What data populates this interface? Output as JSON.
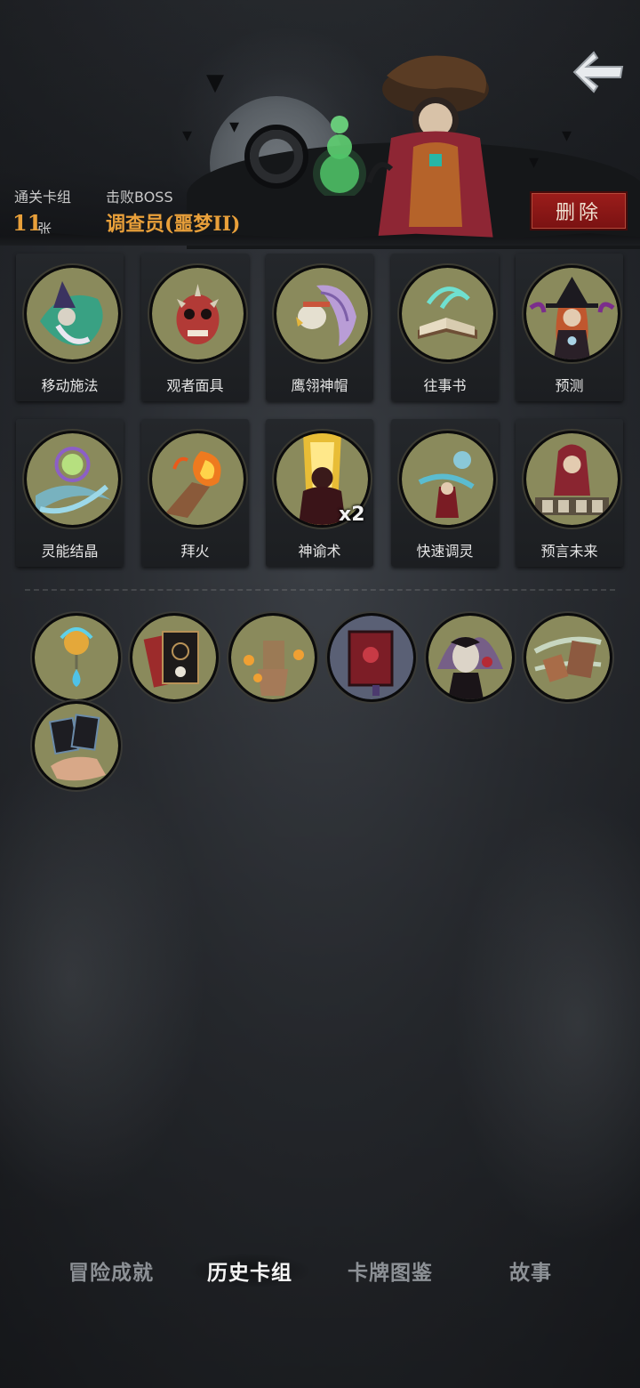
{
  "header": {
    "cleared_deck_label": "通关卡组",
    "card_count": "11",
    "card_unit": "张",
    "defeated_boss_label": "击败BOSS",
    "boss_name": "调查员(噩梦II)",
    "delete_label": "删除"
  },
  "cards": [
    {
      "name": "移动施法",
      "icon": "wizard-icon"
    },
    {
      "name": "观者面具",
      "icon": "mask-icon"
    },
    {
      "name": "鹰翎神帽",
      "icon": "feather-headdress-icon"
    },
    {
      "name": "往事书",
      "icon": "book-icon"
    },
    {
      "name": "预测",
      "icon": "witch-icon"
    },
    {
      "name": "灵能结晶",
      "icon": "crystal-icon"
    },
    {
      "name": "拜火",
      "icon": "fire-icon"
    },
    {
      "name": "神谕术",
      "icon": "oracle-icon",
      "count": "x2"
    },
    {
      "name": "快速调灵",
      "icon": "spirit-icon"
    },
    {
      "name": "预言未来",
      "icon": "fortune-teller-icon"
    }
  ],
  "relics": [
    {
      "icon": "flower-lamp-icon"
    },
    {
      "icon": "skull-card-icon"
    },
    {
      "icon": "candle-hands-icon"
    },
    {
      "icon": "red-tome-icon"
    },
    {
      "icon": "vampire-icon"
    },
    {
      "icon": "flying-card-icon"
    },
    {
      "icon": "hand-cards-icon"
    }
  ],
  "tabs": [
    "冒险成就",
    "历史卡组",
    "卡牌图鉴",
    "故事"
  ],
  "active_tab": "历史卡组",
  "colors": {
    "accent_orange": "#e9a03a",
    "delete_red": "#8b1716",
    "card_inner": "#8a8a5c"
  }
}
